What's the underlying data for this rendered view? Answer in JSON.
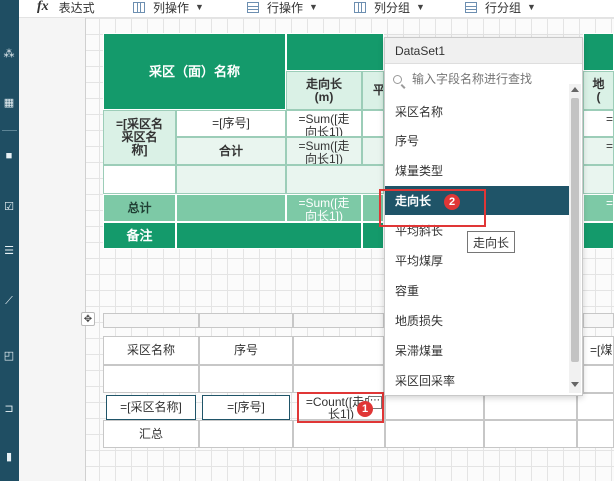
{
  "toolbar": {
    "fx_label": "fx",
    "expression": "表达式",
    "col_op": "列操作",
    "row_op": "行操作",
    "col_group": "列分组",
    "row_group": "行分组"
  },
  "table1": {
    "title": "采区（面）名称",
    "h_len": "走向长\n(m)",
    "h_avg": "平",
    "h_zone": "采区名\n称]",
    "h_zone_expr": "=[采区名",
    "seq": "=[序号]",
    "subtotal": "合计",
    "sum1": "=Sum([走\n向长1])",
    "total": "总计",
    "remark": "备注",
    "right_h1": "地",
    "right_h2": "(",
    "right_c": "=S"
  },
  "table2": {
    "h_name": "采区名称",
    "h_seq": "序号",
    "h_right": "=[煤",
    "zone_expr": "=[采区名称]",
    "seq_expr": "=[序号]",
    "count_expr": "=Count([走向\n长1])",
    "summary": "汇总"
  },
  "dropdown": {
    "title": "DataSet1",
    "search_placeholder": "输入字段名称进行查找",
    "items": [
      "采区名称",
      "序号",
      "煤量类型",
      "走向长",
      "平均斜长",
      "平均煤厚",
      "容重",
      "地质损失",
      "呆滞煤量",
      "采区回采率"
    ],
    "selected_index": 3
  },
  "tooltip": "走向长",
  "badges": {
    "one": "1",
    "two": "2"
  },
  "colors": {
    "header_green": "#149a6b",
    "selected_blue": "#1f5468",
    "highlight_red": "#e03636"
  }
}
